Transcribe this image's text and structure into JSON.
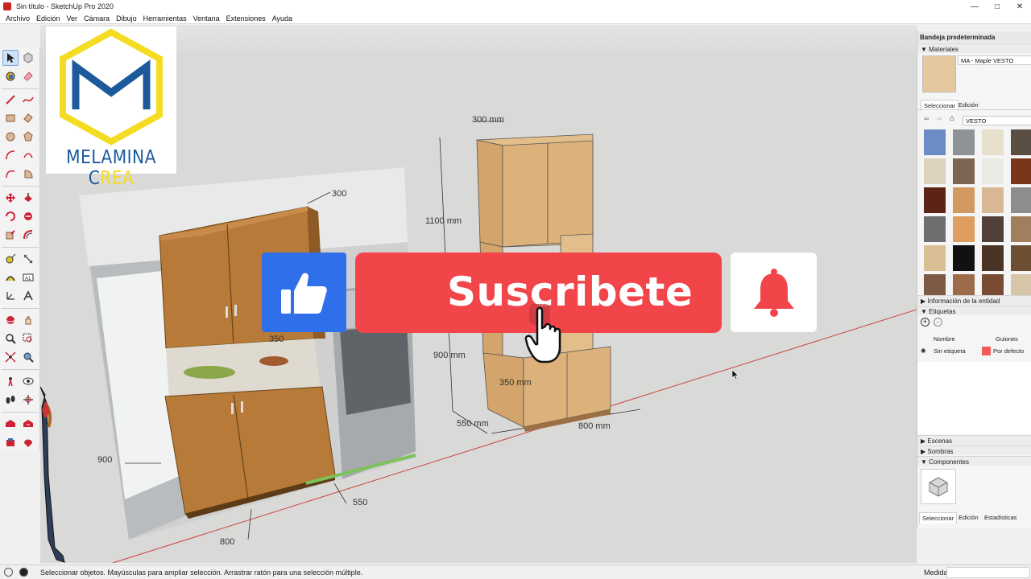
{
  "window": {
    "title": "Sin título - SketchUp Pro 2020"
  },
  "menu": [
    "Archivo",
    "Edición",
    "Ver",
    "Cámara",
    "Dibujo",
    "Herramientas",
    "Ventana",
    "Extensiones",
    "Ayuda"
  ],
  "logo": {
    "text_part1": "MELAMINA C",
    "text_part2": "REA"
  },
  "overlay": {
    "subscribe_label": "Suscribete"
  },
  "model": {
    "dim_top": "300 mm",
    "dim_upper_height": "1100 mm",
    "dim_lower_height": "900 mm",
    "dim_inner_depth": "350 mm",
    "dim_depth": "550 mm",
    "dim_width": "800 mm"
  },
  "photo": {
    "dim_top": "300",
    "dim_mid": "350",
    "dim_height": "900",
    "dim_depth": "550",
    "dim_width": "800"
  },
  "tray": {
    "title": "Bandeja predeterminada",
    "materials_header": "Materiales",
    "material_name": "MA - Maple VESTO",
    "tab_select": "Seleccionar",
    "tab_edit": "Edición",
    "collection": "VESTO",
    "entity_info_header": "Información de la entidad",
    "tags_header": "Etiquetas",
    "tags_col_name": "Nombre",
    "tags_col_dashes": "Guiones",
    "tag_row_name": "Sin etiqueta",
    "tag_row_dashes": "Por defecto",
    "scenes_header": "Escenas",
    "shadows_header": "Sombras",
    "components_header": "Componentes",
    "comp_tab_select": "Seleccionar",
    "comp_tab_edit": "Edición",
    "comp_tab_stats": "Estadísticas",
    "swatch_colors": [
      "#6b8cc4",
      "#8f9295",
      "#e6e0cd",
      "#5a4e45",
      "#ddd3bf",
      "#7c6653",
      "#eceae5",
      "#7a3618",
      "#5b2414",
      "#d29a62",
      "#d9b896",
      "#8c8d8f",
      "#6c6e70",
      "#dd9e60",
      "#514037",
      "#a07f5e",
      "#d9bf94",
      "#111111",
      "#4a3426",
      "#6e4f33",
      "#7d5a45",
      "#9c6c4a",
      "#7a4b33",
      "#d7c5a8"
    ],
    "accent_color": "#f05a5a"
  },
  "status": {
    "text": "Seleccionar objetos. Mayúsculas para ampliar selección. Arrastrar ratón para una selección múltiple.",
    "measures_label": "Medidas"
  }
}
